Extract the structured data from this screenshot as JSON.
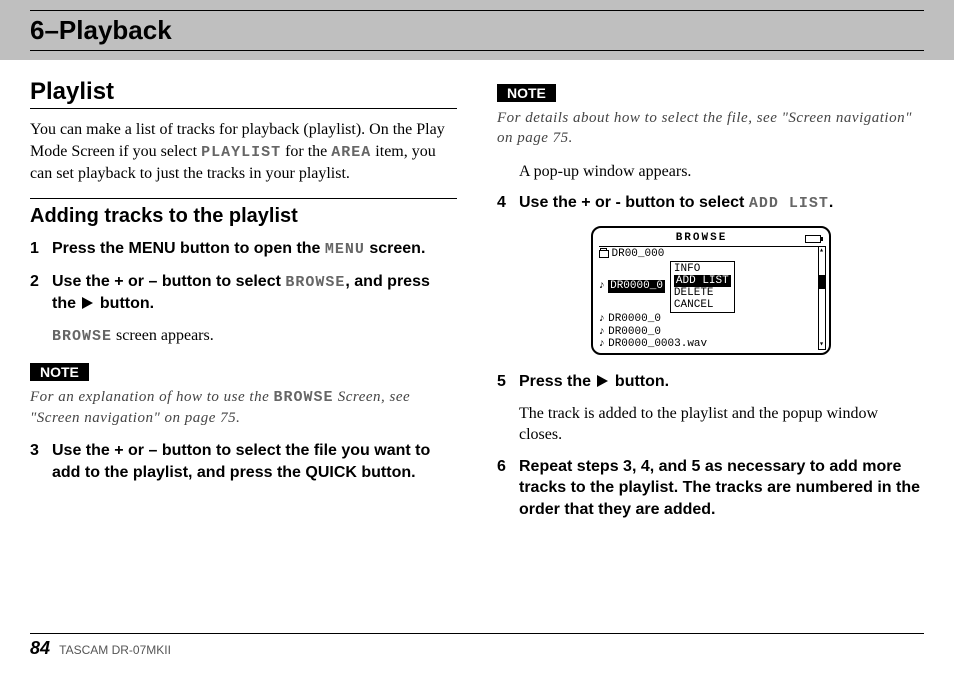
{
  "header": {
    "chapter_title": "6–Playback"
  },
  "left": {
    "section_title": "Playlist",
    "intro_1": "You can make a list of tracks for playback (playlist). On the Play Mode Screen if you select ",
    "lcd_playlist": "PLAYLIST",
    "intro_2": " for the ",
    "lcd_area": "AREA",
    "intro_3": " item, you can set playback to just the tracks in your playlist.",
    "subsection_title": "Adding tracks to the playlist",
    "step1_a": "Press the MENU button to open the ",
    "step1_lcd": "MENU",
    "step1_b": " screen.",
    "step2_a": "Use the + or – button to select ",
    "step2_lcd": "BROWSE",
    "step2_b": ", and press the ",
    "step2_c": " button.",
    "step2_result_a": "",
    "step2_result_lcd": "BROWSE",
    "step2_result_b": " screen appears.",
    "note_label": "NOTE",
    "note_a": "For an explanation of how to use the ",
    "note_lcd": "BROWSE",
    "note_b": " Screen, see \"Screen navigation\" on page 75.",
    "step3": "Use the + or – button to select the file you want to add to the playlist, and press the QUICK button."
  },
  "right": {
    "note_label": "NOTE",
    "note_text": "For details about how to select the file, see \"Screen navigation\" on page 75.",
    "pre4": "A pop-up window appears.",
    "step4_a": "Use the + or - button to select ",
    "step4_lcd": "ADD LIST",
    "step4_b": ".",
    "lcd": {
      "title": "BROWSE",
      "folder": "DR00_000",
      "row_sel": "DR0000_0",
      "rows": [
        "DR0000_0",
        "DR0000_0",
        "DR0000_0003.wav"
      ],
      "popup": [
        "INFO",
        "ADD LIST",
        "DELETE",
        "CANCEL"
      ]
    },
    "step5_a": "Press the ",
    "step5_b": " button.",
    "step5_result": "The track is added to the playlist and the popup window closes.",
    "step6": "Repeat steps 3, 4, and 5 as necessary to add more tracks to the playlist. The tracks are numbered in the order that they are added."
  },
  "footer": {
    "page": "84",
    "model": "TASCAM DR-07MKII"
  }
}
